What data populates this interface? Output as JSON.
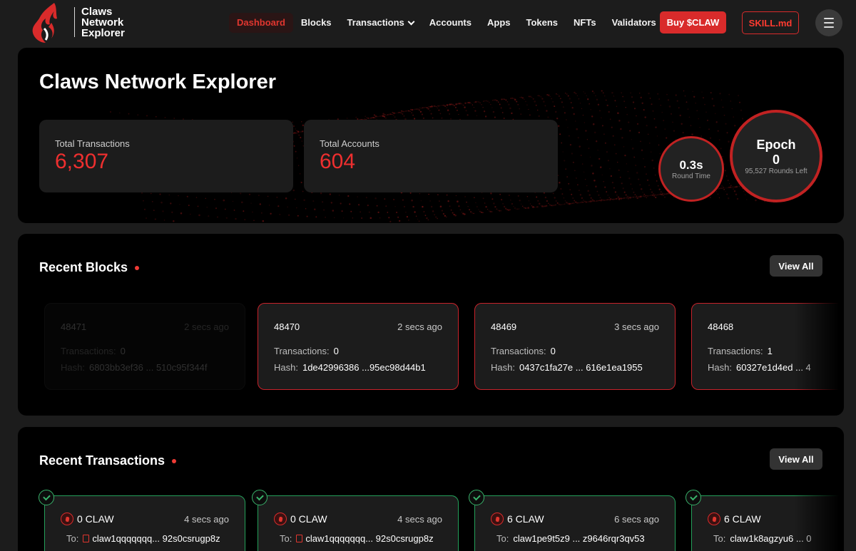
{
  "brand": {
    "lines": [
      "Claws",
      "Network",
      "Explorer"
    ]
  },
  "nav": {
    "links": [
      {
        "label": "Dashboard",
        "active": true
      },
      {
        "label": "Blocks"
      },
      {
        "label": "Transactions",
        "dropdown": true
      },
      {
        "label": "Accounts"
      },
      {
        "label": "Apps"
      },
      {
        "label": "Tokens"
      },
      {
        "label": "NFTs"
      },
      {
        "label": "Validators"
      }
    ],
    "buy_label": "Buy $CLAW",
    "skill_label": "SKILL.md",
    "menu_icon": "hamburger-icon"
  },
  "hero": {
    "title": "Claws Network Explorer",
    "total_transactions_label": "Total Transactions",
    "total_transactions_value": "6,307",
    "total_accounts_label": "Total Accounts",
    "total_accounts_value": "604",
    "round_time_value": "0.3s",
    "round_time_label": "Round Time",
    "epoch_label": "Epoch",
    "epoch_value": "0",
    "rounds_left": "95,527 Rounds Left"
  },
  "recent_blocks": {
    "title": "Recent Blocks",
    "view_all": "View All",
    "tx_label": "Transactions:",
    "hash_label": "Hash:",
    "items": [
      {
        "number": "48471",
        "time": "2 secs ago",
        "transactions": "0",
        "hash": "6803bb3ef36 ... 510c95f344f"
      },
      {
        "number": "48470",
        "time": "2 secs ago",
        "transactions": "0",
        "hash": "1de42996386 ...95ec98d44b1"
      },
      {
        "number": "48469",
        "time": "3 secs ago",
        "transactions": "0",
        "hash": "0437c1fa27e ... 616e1ea1955"
      },
      {
        "number": "48468",
        "time": "",
        "transactions": "1",
        "hash": "60327e1d4ed ... 4"
      }
    ]
  },
  "recent_transactions": {
    "title": "Recent Transactions",
    "view_all": "View All",
    "to_label": "To:",
    "items": [
      {
        "amount": "0 CLAW",
        "time": "4 secs ago",
        "to": "claw1qqqqqqq... 92s0csrugp8z",
        "contract": true
      },
      {
        "amount": "0 CLAW",
        "time": "4 secs ago",
        "to": "claw1qqqqqqq... 92s0csrugp8z",
        "contract": true
      },
      {
        "amount": "6 CLAW",
        "time": "6 secs ago",
        "to": "claw1pe9t5z9 ... z9646rqr3qv53",
        "contract": false
      },
      {
        "amount": "6 CLAW",
        "time": "",
        "to": "claw1k8agzyu6 ... 0",
        "contract": false
      }
    ]
  },
  "colors": {
    "accent": "#e0362f",
    "success": "#39b36b",
    "background": "#1c1c1c",
    "panel": "#000000"
  }
}
